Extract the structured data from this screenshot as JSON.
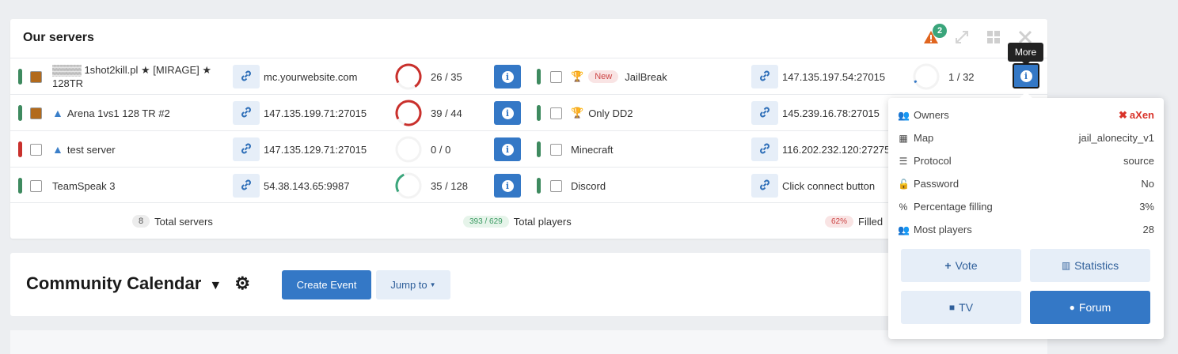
{
  "servers_panel": {
    "title": "Our servers",
    "alert_count": "2",
    "left_rows": [
      {
        "status_color": "#3e8a5f",
        "game_color": "#b26a1c",
        "warn": false,
        "name": "▒▒▒▒ 1shot2kill.pl ★ [MIRAGE] ★ 128TR",
        "address": "mc.yourwebsite.com",
        "players": "26 / 35",
        "fill": 0.74,
        "ring_color": "#c9302c"
      },
      {
        "status_color": "#3e8a5f",
        "game_color": "#b26a1c",
        "warn": true,
        "name": "Arena 1vs1 128 TR #2",
        "address": "147.135.199.71:27015",
        "players": "39 / 44",
        "fill": 0.89,
        "ring_color": "#c9302c"
      },
      {
        "status_color": "#c9302c",
        "game_color": "#ffffff",
        "warn": true,
        "name": "test server",
        "address": "147.135.129.71:27015",
        "players": "0 / 0",
        "fill": 0,
        "ring_color": "#cccccc"
      },
      {
        "status_color": "#3e8a5f",
        "game_color": "#ffffff",
        "warn": false,
        "name": "TeamSpeak 3",
        "address": "54.38.143.65:9987",
        "players": "35 / 128",
        "fill": 0.27,
        "ring_color": "#3aa57b"
      }
    ],
    "right_rows": [
      {
        "status_color": "#3e8a5f",
        "trophy": true,
        "new_label": "New",
        "name": "JailBreak",
        "address": "147.135.197.54:27015",
        "players": "1 / 32",
        "fill": 0.03
      },
      {
        "status_color": "#3e8a5f",
        "trophy": true,
        "new_label": "",
        "name": "Only DD2",
        "address": "145.239.16.78:27015",
        "players": "",
        "fill": 0
      },
      {
        "status_color": "#3e8a5f",
        "trophy": false,
        "new_label": "",
        "name": "Minecraft",
        "address": "116.202.232.120:27275",
        "players": "",
        "fill": 0
      },
      {
        "status_color": "#3e8a5f",
        "trophy": false,
        "new_label": "",
        "name": "Discord",
        "address": "Click connect button",
        "players": "",
        "fill": 0
      }
    ],
    "footer": {
      "servers_count": "8",
      "servers_label": "Total servers",
      "players_count": "393 / 629",
      "players_label": "Total players",
      "filled_pct": "62%",
      "filled_label": "Filled"
    }
  },
  "tooltip": "More",
  "popup": {
    "rows": [
      {
        "icon": "users-icon",
        "label": "Owners",
        "value": "aXen"
      },
      {
        "icon": "map-icon",
        "label": "Map",
        "value": "jail_alonecity_v1"
      },
      {
        "icon": "server-icon",
        "label": "Protocol",
        "value": "source"
      },
      {
        "icon": "lock-icon",
        "label": "Password",
        "value": "No"
      },
      {
        "icon": "percent-icon",
        "label": "Percentage filling",
        "value": "3%"
      },
      {
        "icon": "users-icon",
        "label": "Most players",
        "value": "28"
      }
    ],
    "buttons": {
      "vote": "Vote",
      "statistics": "Statistics",
      "tv": "TV",
      "forum": "Forum"
    }
  },
  "calendar": {
    "title": "Community Calendar",
    "create": "Create Event",
    "jump": "Jump to"
  },
  "colors": {
    "accent": "#3478c6",
    "owner": "#d9342b"
  }
}
